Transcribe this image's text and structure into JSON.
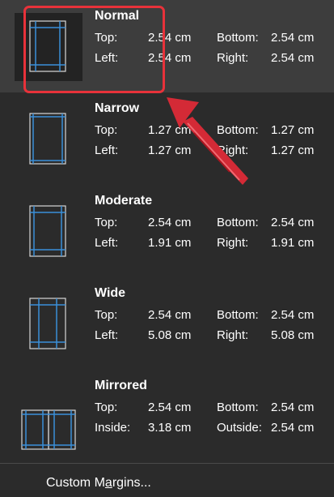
{
  "menu": {
    "items": [
      {
        "name": "Normal",
        "l1": "Top:",
        "v1": "2.54 cm",
        "l2": "Bottom:",
        "v2": "2.54 cm",
        "l3": "Left:",
        "v3": "2.54 cm",
        "l4": "Right:",
        "v4": "2.54 cm"
      },
      {
        "name": "Narrow",
        "l1": "Top:",
        "v1": "1.27 cm",
        "l2": "Bottom:",
        "v2": "1.27 cm",
        "l3": "Left:",
        "v3": "1.27 cm",
        "l4": "Right:",
        "v4": "1.27 cm"
      },
      {
        "name": "Moderate",
        "l1": "Top:",
        "v1": "2.54 cm",
        "l2": "Bottom:",
        "v2": "2.54 cm",
        "l3": "Left:",
        "v3": "1.91 cm",
        "l4": "Right:",
        "v4": "1.91 cm"
      },
      {
        "name": "Wide",
        "l1": "Top:",
        "v1": "2.54 cm",
        "l2": "Bottom:",
        "v2": "2.54 cm",
        "l3": "Left:",
        "v3": "5.08 cm",
        "l4": "Right:",
        "v4": "5.08 cm"
      },
      {
        "name": "Mirrored",
        "l1": "Top:",
        "v1": "2.54 cm",
        "l2": "Bottom:",
        "v2": "2.54 cm",
        "l3": "Inside:",
        "v3": "3.18 cm",
        "l4": "Outside:",
        "v4": "2.54 cm"
      }
    ],
    "custom_pre": "Custom M",
    "custom_u": "a",
    "custom_post": "rgins..."
  },
  "colors": {
    "accent": "#e8323a",
    "guide": "#3a8fd9",
    "page_border": "#d8d8d8"
  }
}
